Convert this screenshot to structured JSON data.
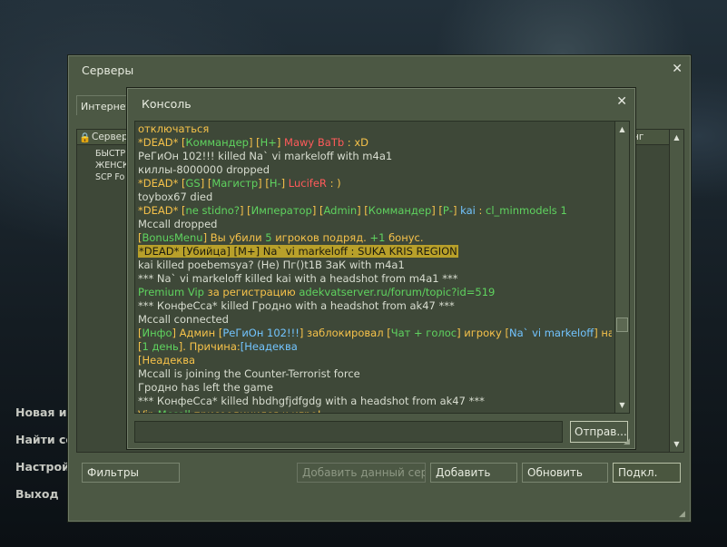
{
  "main_menu": [
    "Новая иг",
    "Найти се",
    "Настрой",
    "Выход"
  ],
  "servers_window": {
    "title": "Серверы",
    "tab": "Интернет",
    "header_col1": "Серверы",
    "header_col_right": "нг",
    "rows": [
      "БЫСТРЕ",
      "ЖЕНСК",
      "SCP Fo"
    ],
    "buttons": {
      "filters": "Фильтры",
      "add_this": "Добавить данный сер...",
      "add": "Добавить",
      "refresh": "Обновить",
      "connect": "Подкл."
    }
  },
  "console": {
    "title": "Консоль",
    "submit": "Отправ...",
    "lines": [
      [
        {
          "t": "отключаться",
          "c": "y"
        }
      ],
      [
        {
          "t": "*DEAD* ",
          "c": "y"
        },
        {
          "t": "[",
          "c": "y"
        },
        {
          "t": "Коммандер",
          "c": "g"
        },
        {
          "t": "] [",
          "c": "y"
        },
        {
          "t": "Н+",
          "c": "g"
        },
        {
          "t": "] ",
          "c": "y"
        },
        {
          "t": "Mawy BaTb",
          "c": "r"
        },
        {
          "t": " : xD",
          "c": "y"
        }
      ],
      [
        {
          "t": "РеГиОн 102!!! killed Na` vi markeloff with m4a1",
          "c": "w"
        }
      ],
      [
        {
          "t": "киллы-8000000 dropped",
          "c": "w"
        }
      ],
      [
        {
          "t": "*DEAD* ",
          "c": "y"
        },
        {
          "t": "[",
          "c": "y"
        },
        {
          "t": "GS",
          "c": "g"
        },
        {
          "t": "] [",
          "c": "y"
        },
        {
          "t": "Магистр",
          "c": "g"
        },
        {
          "t": "] [",
          "c": "y"
        },
        {
          "t": "Н-",
          "c": "g"
        },
        {
          "t": "] ",
          "c": "y"
        },
        {
          "t": "LucifeR",
          "c": "r"
        },
        {
          "t": " : )",
          "c": "y"
        }
      ],
      [
        {
          "t": "toybox67 died",
          "c": "w"
        }
      ],
      [
        {
          "t": "*DEAD* ",
          "c": "y"
        },
        {
          "t": "[",
          "c": "y"
        },
        {
          "t": "ne stidno?",
          "c": "g"
        },
        {
          "t": "] [",
          "c": "y"
        },
        {
          "t": "Император",
          "c": "g"
        },
        {
          "t": "] [",
          "c": "y"
        },
        {
          "t": "Admin",
          "c": "g"
        },
        {
          "t": "] [",
          "c": "y"
        },
        {
          "t": "Коммандер",
          "c": "g"
        },
        {
          "t": "] [",
          "c": "y"
        },
        {
          "t": "Р-",
          "c": "g"
        },
        {
          "t": "] ",
          "c": "y"
        },
        {
          "t": "kai",
          "c": "b"
        },
        {
          "t": " : ",
          "c": "y"
        },
        {
          "t": "cl_minmodels 1",
          "c": "g"
        }
      ],
      [
        {
          "t": "Mccall dropped",
          "c": "w"
        }
      ],
      [
        {
          "t": "[",
          "c": "y"
        },
        {
          "t": "BonusMenu",
          "c": "g"
        },
        {
          "t": "] ",
          "c": "y"
        },
        {
          "t": "Вы убили ",
          "c": "y"
        },
        {
          "t": "5",
          "c": "g"
        },
        {
          "t": " игроков подряд. ",
          "c": "y"
        },
        {
          "t": "+1",
          "c": "g"
        },
        {
          "t": " бонус.",
          "c": "y"
        }
      ],
      [
        {
          "t": "*DEAD* [Убийца] [M+] Na` vi markeloff : SUKA KRIS REGION",
          "c": "hl"
        }
      ],
      [
        {
          "t": "kai killed poebemsya? (Не) Пг()t1В ЗаК with m4a1",
          "c": "w"
        }
      ],
      [
        {
          "t": "*** Na` vi markeloff killed kai with a headshot from m4a1 ***",
          "c": "w"
        }
      ],
      [
        {
          "t": "Premium Vip",
          "c": "g"
        },
        {
          "t": " за регистрацию ",
          "c": "y"
        },
        {
          "t": "adekvatserver.ru/forum/topic?id=519",
          "c": "g"
        }
      ],
      [
        {
          "t": "*** КонфеСса* killed Гродно with a headshot from ak47 ***",
          "c": "w"
        }
      ],
      [
        {
          "t": "Mccall connected",
          "c": "w"
        }
      ],
      [
        {
          "t": "[",
          "c": "y"
        },
        {
          "t": "Инфо",
          "c": "g"
        },
        {
          "t": "] ",
          "c": "y"
        },
        {
          "t": "Админ ",
          "c": "y"
        },
        {
          "t": "[",
          "c": "y"
        },
        {
          "t": "РеГиОн 102!!!",
          "c": "b"
        },
        {
          "t": "] ",
          "c": "y"
        },
        {
          "t": "заблокировал ",
          "c": "y"
        },
        {
          "t": "[",
          "c": "y"
        },
        {
          "t": "Чат + голос",
          "c": "g"
        },
        {
          "t": "] ",
          "c": "y"
        },
        {
          "t": "игроку ",
          "c": "y"
        },
        {
          "t": "[",
          "c": "y"
        },
        {
          "t": "Na` vi markeloff",
          "c": "b"
        },
        {
          "t": "] ",
          "c": "y"
        },
        {
          "t": "на",
          "c": "y"
        }
      ],
      [
        {
          "t": "[",
          "c": "y"
        },
        {
          "t": "1 день",
          "c": "g"
        },
        {
          "t": "]. ",
          "c": "y"
        },
        {
          "t": "Причина:",
          "c": "y"
        },
        {
          "t": "[Неадекв",
          "c": "b"
        },
        {
          "t": "а",
          "c": "b"
        }
      ],
      [
        {
          "t": "[Неадеква",
          "c": "y"
        }
      ],
      [
        {
          "t": "Mccall is joining the Counter-Terrorist force",
          "c": "w"
        }
      ],
      [
        {
          "t": "Гродно has left the game",
          "c": "w"
        }
      ],
      [
        {
          "t": "*** КонфеСса* killed hbdhgfjdfgdg with a headshot from ak47 ***",
          "c": "w"
        }
      ],
      [
        {
          "t": "Vip ",
          "c": "y"
        },
        {
          "t": "Mccall",
          "c": "g"
        },
        {
          "t": " присоединился к игре!",
          "c": "y"
        }
      ]
    ]
  },
  "colors": {
    "yellow": "#f6c24a",
    "green": "#5fd35f",
    "red": "#ff5a5a",
    "blue": "#72c4ff",
    "panel": "#4c5844"
  }
}
